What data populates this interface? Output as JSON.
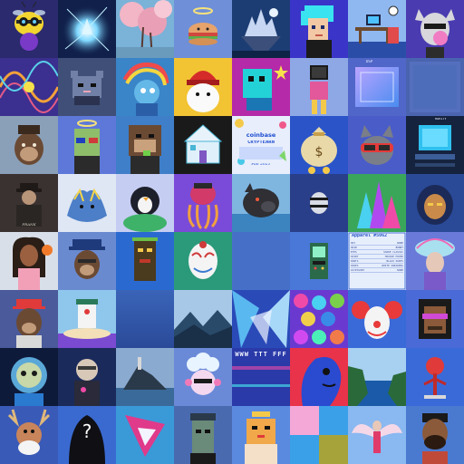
{
  "tiles": [
    {
      "name": "bee-robot"
    },
    {
      "name": "blue-energy-crystal"
    },
    {
      "name": "cherry-blossom-landscape"
    },
    {
      "name": "burger-halo"
    },
    {
      "name": "floating-castle"
    },
    {
      "name": "cyan-hair-pixel-punk"
    },
    {
      "name": "office-room-scene"
    },
    {
      "name": "rat-bubblegum"
    },
    {
      "name": "fractal-pattern"
    },
    {
      "name": "pixel-cat-hoodie"
    },
    {
      "name": "rainbow-hair-creature"
    },
    {
      "name": "red-beanie-ghost"
    },
    {
      "name": "pixel-cyan-creature-star"
    },
    {
      "name": "monitor-head-fashion"
    },
    {
      "name": "dsp-gradient-panel"
    },
    {
      "name": "noise-blue-square"
    },
    {
      "name": "bored-ape-hat"
    },
    {
      "name": "halo-pixel-zombie"
    },
    {
      "name": "pixel-ape-tongue"
    },
    {
      "name": "pixel-house-doodle"
    },
    {
      "name": "coinbase-cryptearn-poster"
    },
    {
      "name": "money-bag-character"
    },
    {
      "name": "cat-with-goggles"
    },
    {
      "name": "rarity-panel"
    },
    {
      "name": "gangster-photo-frank"
    },
    {
      "name": "blue-beast-sketch"
    },
    {
      "name": "penguin-bush"
    },
    {
      "name": "psychedelic-octopus"
    },
    {
      "name": "boar-seaside"
    },
    {
      "name": "metal-capsule"
    },
    {
      "name": "colorful-ice-creature"
    },
    {
      "name": "hooded-face-avatar"
    },
    {
      "name": "girl-basketball"
    },
    {
      "name": "ape-captain-hat"
    },
    {
      "name": "pixel-tiki-face"
    },
    {
      "name": "opera-mask"
    },
    {
      "name": "empty-blue-slot"
    },
    {
      "name": "arcade-machine"
    },
    {
      "name": "apparel-traits-card"
    },
    {
      "name": "ornate-woman-headdress"
    },
    {
      "name": "ape-red-cap"
    },
    {
      "name": "cartoon-robot-sea"
    },
    {
      "name": "blue-gradient-slot"
    },
    {
      "name": "misty-mountains"
    },
    {
      "name": "abstract-blue-shards"
    },
    {
      "name": "hex-color-mosaic"
    },
    {
      "name": "evil-clown"
    },
    {
      "name": "pixel-purple-shades"
    },
    {
      "name": "astronaut-skull"
    },
    {
      "name": "cyber-boy-portrait"
    },
    {
      "name": "island-tower"
    },
    {
      "name": "cloud-hair-pet"
    },
    {
      "name": "glitch-letters-poster"
    },
    {
      "name": "blue-skull-woman-profile"
    },
    {
      "name": "coastal-cliffs"
    },
    {
      "name": "red-tree-figure"
    },
    {
      "name": "moose-santa"
    },
    {
      "name": "mystery-silhouette"
    },
    {
      "name": "abstract-pink-shard"
    },
    {
      "name": "pixel-punk-cap"
    },
    {
      "name": "pixel-cat-crown"
    },
    {
      "name": "pastel-color-blocks"
    },
    {
      "name": "angel-winged-figure"
    },
    {
      "name": "bearded-man-3d"
    }
  ],
  "text": {
    "coinbase_brand": "coinbase",
    "coinbase_line": "CRYPTEARN",
    "coinbase_signature": "Fall 2021",
    "dsp_label": "DSP",
    "rarity_label": "RARITY",
    "apparel_title": "Apparel #5062",
    "apparel_rows": [
      {
        "k": "HAT",
        "v": "NONE"
      },
      {
        "k": "HAIR",
        "v": "BUNNY"
      },
      {
        "k": "EYES",
        "v": "SHADE CLASSIC"
      },
      {
        "k": "SHIRT",
        "v": "HOODIE MIXED"
      },
      {
        "k": "PANTS",
        "v": "BLACK PANTS"
      },
      {
        "k": "SHOES",
        "v": "WHITE SNEAKERS"
      },
      {
        "k": "ACCESSORY",
        "v": "NONE"
      }
    ],
    "frank_caption": "FRANK",
    "glitch_text": "WWW TTT FFF",
    "question_mark": "?"
  },
  "colors": {
    "background": "#2a3558",
    "accent_blue": "#3d6cf0",
    "pink": "#f4a8d8",
    "olive": "#a7a33b",
    "sky": "#3aa0e8"
  }
}
